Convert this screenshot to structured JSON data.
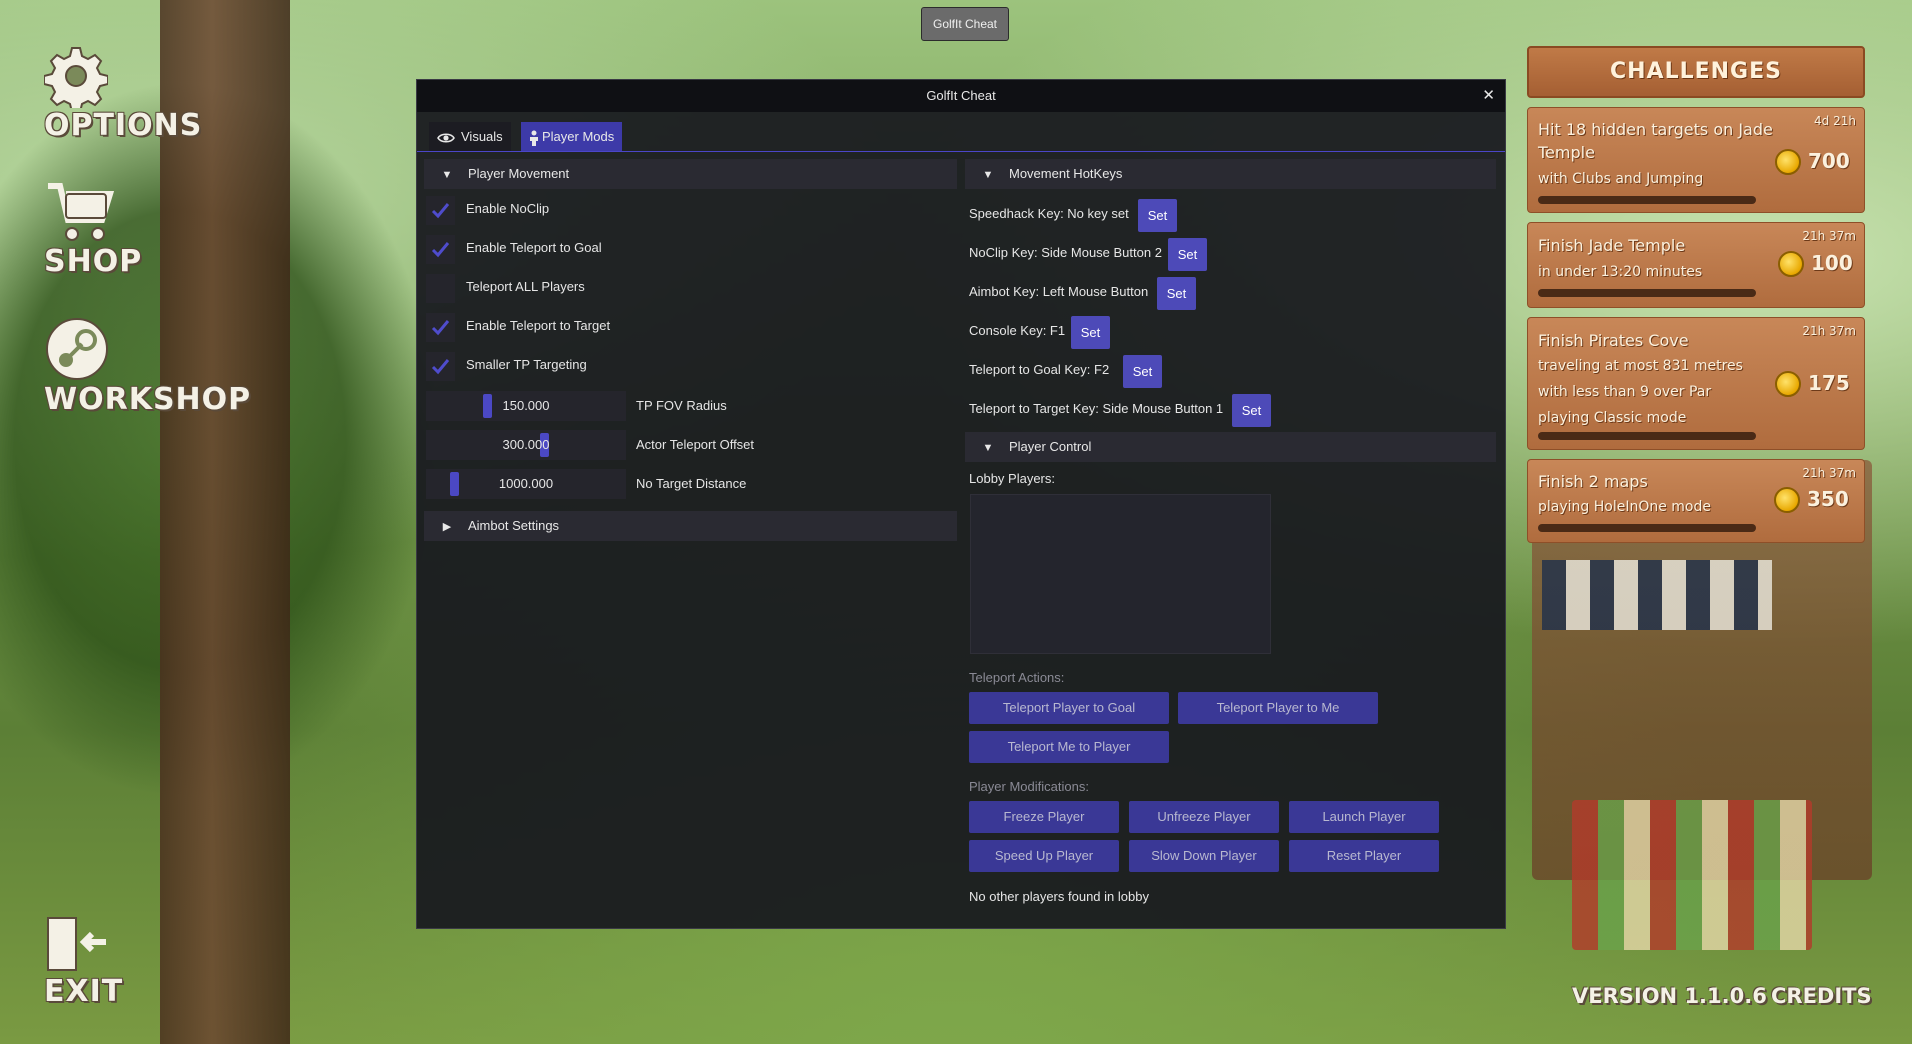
{
  "game_menu": {
    "options": "OPTIONS",
    "shop": "SHOP",
    "workshop": "WORKSHOP",
    "exit": "EXIT"
  },
  "top_button": "GolfIt Cheat",
  "window": {
    "title": "GolfIt Cheat",
    "tabs": [
      {
        "label": "Visuals",
        "icon": "eye-icon",
        "active": false
      },
      {
        "label": "Player Mods",
        "icon": "person-icon",
        "active": true
      }
    ],
    "player_movement": {
      "header": "Player Movement",
      "checkboxes": [
        {
          "label": "Enable NoClip",
          "checked": true
        },
        {
          "label": "Enable Teleport to Goal",
          "checked": true
        },
        {
          "label": "Teleport ALL Players",
          "checked": false
        },
        {
          "label": "Enable Teleport to Target",
          "checked": true
        },
        {
          "label": "Smaller TP Targeting",
          "checked": true
        }
      ],
      "sliders": [
        {
          "value": "150.000",
          "label": "TP FOV Radius"
        },
        {
          "value": "300.000",
          "label": "Actor Teleport Offset"
        },
        {
          "value": "1000.000",
          "label": "No Target Distance"
        }
      ]
    },
    "aimbot": {
      "header": "Aimbot Settings"
    },
    "movement_hotkeys": {
      "header": "Movement HotKeys",
      "rows": [
        {
          "label": "Speedhack Key: No key set",
          "button": "Set"
        },
        {
          "label": "NoClip Key: Side Mouse Button 2",
          "button": "Set"
        },
        {
          "label": "Aimbot Key: Left Mouse Button",
          "button": "Set"
        },
        {
          "label": "Console Key: F1",
          "button": "Set"
        },
        {
          "label": "Teleport to Goal Key: F2",
          "button": "Set"
        },
        {
          "label": "Teleport to Target Key: Side Mouse Button 1",
          "button": "Set"
        }
      ]
    },
    "player_control": {
      "header": "Player Control",
      "lobby_label": "Lobby Players:",
      "teleport_label": "Teleport Actions:",
      "teleport_buttons": [
        "Teleport Player to Goal",
        "Teleport Player to Me",
        "Teleport Me to Player"
      ],
      "mods_label": "Player Modifications:",
      "mod_buttons": [
        "Freeze Player",
        "Unfreeze Player",
        "Launch Player",
        "Speed Up Player",
        "Slow Down Player",
        "Reset Player"
      ],
      "status": "No other players found in lobby"
    }
  },
  "challenges": {
    "header": "CHALLENGES",
    "items": [
      {
        "lines": [
          "Hit 18 hidden targets on Jade",
          "Temple",
          "with Clubs and Jumping"
        ],
        "time": "4d 21h",
        "reward": "700"
      },
      {
        "lines": [
          "Finish Jade Temple",
          "in under 13:20 minutes"
        ],
        "time": "21h 37m",
        "reward": "100"
      },
      {
        "lines": [
          "Finish Pirates Cove",
          "traveling at most 831 metres",
          "with less than 9 over Par",
          "playing Classic mode"
        ],
        "time": "21h 37m",
        "reward": "175"
      },
      {
        "lines": [
          "Finish 2 maps",
          "playing HoleInOne mode"
        ],
        "time": "21h 37m",
        "reward": "350"
      }
    ]
  },
  "footer": {
    "version": "VERSION 1.1.0.6",
    "credits": "CREDITS"
  }
}
